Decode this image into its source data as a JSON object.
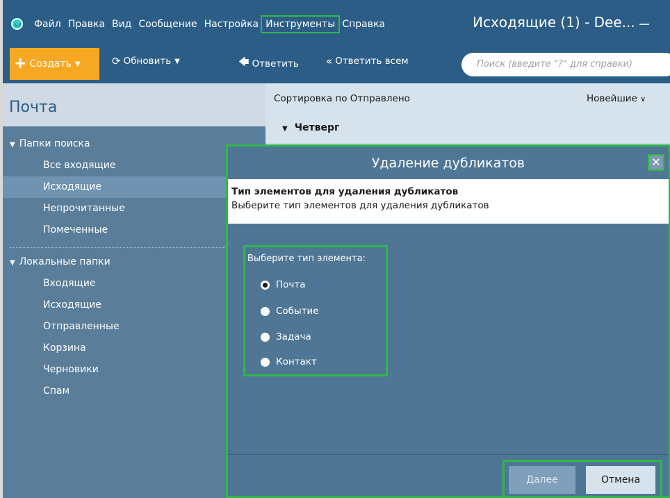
{
  "app": {
    "title": "Исходящие (1) - Dee...",
    "menu": [
      "Файл",
      "Правка",
      "Вид",
      "Сообщение",
      "Настройка",
      "Инструменты",
      "Справка"
    ],
    "highlighted_menu": "Инструменты"
  },
  "toolbar": {
    "create_label": "Создать",
    "refresh_label": "Обновить",
    "reply_label": "Ответить",
    "reply_all_label": "Ответить всем",
    "search_placeholder": "Поиск (введите \"?\" для справки)"
  },
  "sidebar": {
    "title": "Почта",
    "search_folders": {
      "label": "Папки поиска",
      "items": [
        "Все входящие",
        "Исходящие",
        "Непрочитанные",
        "Помеченные"
      ],
      "selected": "Исходящие"
    },
    "local_folders": {
      "label": "Локальные папки",
      "items": [
        "Входящие",
        "Исходящие",
        "Отправленные",
        "Корзина",
        "Черновики",
        "Спам"
      ]
    }
  },
  "list": {
    "sort_label": "Сортировка по Отправлено",
    "sort_order": "Новейшие",
    "group_label": "Четверг"
  },
  "dialog": {
    "title": "Удаление дубликатов",
    "close_icon": "close-icon",
    "info_title": "Тип элементов для удаления дубликатов",
    "info_subtitle": "Выберите тип элементов для удаления дубликатов",
    "type_caption": "Выберите тип элемента:",
    "options": [
      "Почта",
      "Событие",
      "Задача",
      "Контакт"
    ],
    "selected_option": "Почта",
    "next_label": "Далее",
    "cancel_label": "Отмена"
  },
  "colors": {
    "titlebar": "#2b5d86",
    "sidebar": "#5a7d99",
    "accent_orange": "#f7a823",
    "highlight_green": "#2fb84a"
  }
}
